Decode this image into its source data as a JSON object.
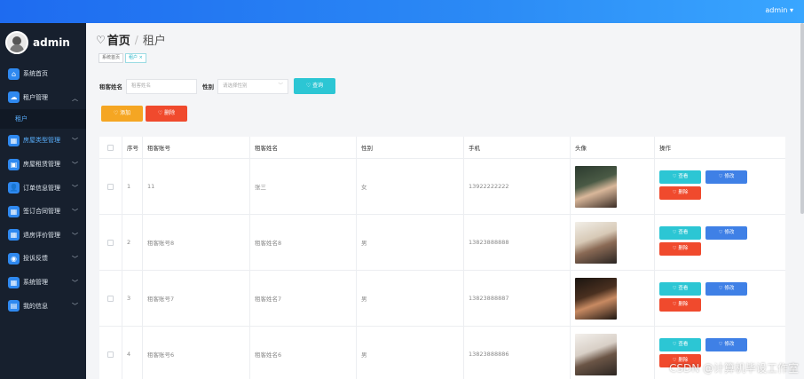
{
  "topbar": {
    "user": "admin ▾"
  },
  "sidebar": {
    "brand": "admin",
    "items": [
      {
        "label": "系统首页",
        "icon": "⌂"
      },
      {
        "label": "租户管理",
        "icon": "☁",
        "expanded": true
      },
      {
        "label": "房屋类型管理",
        "icon": "▦"
      },
      {
        "label": "房屋租赁管理",
        "icon": "▣"
      },
      {
        "label": "订单信息管理",
        "icon": "👤"
      },
      {
        "label": "签订合同管理",
        "icon": "▦"
      },
      {
        "label": "退房评价管理",
        "icon": "▦"
      },
      {
        "label": "投诉反馈",
        "icon": "◉"
      },
      {
        "label": "系统管理",
        "icon": "▦"
      },
      {
        "label": "我的信息",
        "icon": "▤"
      }
    ],
    "sub_item": "租户"
  },
  "breadcrumb": {
    "home": "首页",
    "current": "租户"
  },
  "tags": {
    "home": "系统首页",
    "current": "租户 ×"
  },
  "search": {
    "name_label": "租客姓名",
    "name_placeholder": "租客姓名",
    "gender_label": "性别",
    "gender_placeholder": "请选择性别",
    "search_button": "♡ 查询"
  },
  "actions": {
    "add": "♡ 添加",
    "delete": "♡ 删除"
  },
  "table": {
    "headers": [
      "序号",
      "租客账号",
      "租客姓名",
      "性别",
      "手机",
      "头像",
      "操作"
    ],
    "rows": [
      {
        "idx": "1",
        "account": "11",
        "name": "张三",
        "gender": "女",
        "phone": "13922222222"
      },
      {
        "idx": "2",
        "account": "租客账号8",
        "name": "租客姓名8",
        "gender": "男",
        "phone": "13823888888"
      },
      {
        "idx": "3",
        "account": "租客账号7",
        "name": "租客姓名7",
        "gender": "男",
        "phone": "13823888887"
      },
      {
        "idx": "4",
        "account": "租客账号6",
        "name": "租客姓名6",
        "gender": "男",
        "phone": "13823888886"
      }
    ],
    "op_view": "♡ 查看",
    "op_edit": "♡ 修改",
    "op_delete": "♡ 删除"
  },
  "watermark": "CSDN @计算机毕设工作室"
}
